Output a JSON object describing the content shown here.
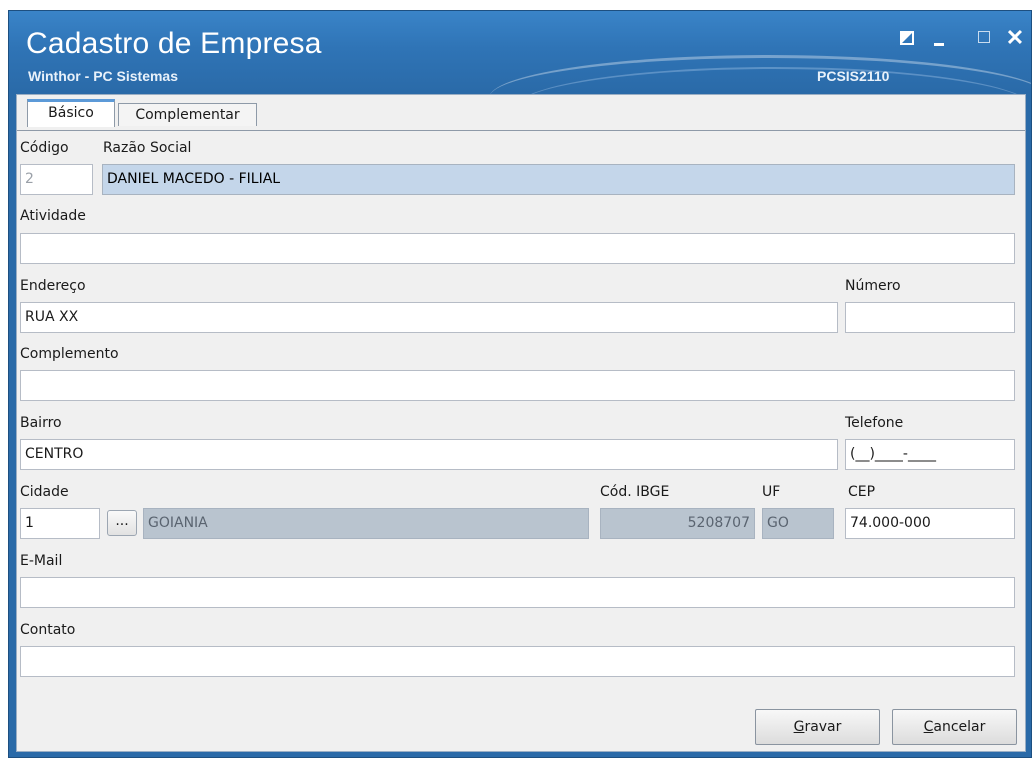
{
  "window": {
    "title": "Cadastro de Empresa",
    "subtitle": "Winthor - PC Sistemas",
    "code": "PCSIS2110",
    "controls": [
      "restore-icon",
      "minimize-icon",
      "maximize-icon",
      "close-icon"
    ],
    "close_glyph": "✕"
  },
  "tabs": [
    {
      "label": "Básico",
      "active": true
    },
    {
      "label": "Complementar",
      "active": false
    }
  ],
  "form": {
    "codigo": {
      "label": "Código",
      "value": "2"
    },
    "razao_social": {
      "label": "Razão Social",
      "value": "DANIEL MACEDO - FILIAL"
    },
    "atividade": {
      "label": "Atividade",
      "value": ""
    },
    "endereco": {
      "label": "Endereço",
      "value": "RUA XX"
    },
    "numero": {
      "label": "Número",
      "value": ""
    },
    "complemento": {
      "label": "Complemento",
      "value": ""
    },
    "bairro": {
      "label": "Bairro",
      "value": "CENTRO"
    },
    "telefone": {
      "label": "Telefone",
      "value": "(__)____-____"
    },
    "cidade": {
      "label": "Cidade",
      "code": "1",
      "button": "...",
      "name": "GOIANIA"
    },
    "cod_ibge": {
      "label": "Cód. IBGE",
      "value": "5208707"
    },
    "uf": {
      "label": "UF",
      "value": "GO"
    },
    "cep": {
      "label": "CEP",
      "value": "74.000-000"
    },
    "email": {
      "label": "E-Mail",
      "value": ""
    },
    "contato": {
      "label": "Contato",
      "value": ""
    }
  },
  "buttons": {
    "gravar": {
      "accel": "G",
      "rest": "ravar"
    },
    "cancelar": {
      "accel": "C",
      "rest": "ancelar"
    }
  },
  "colors": {
    "titlebar": "#2a6aa8",
    "disabled_field": "#b9c4cf",
    "selection": "#c4d6ea",
    "tab_accent": "#5c9ad8"
  }
}
